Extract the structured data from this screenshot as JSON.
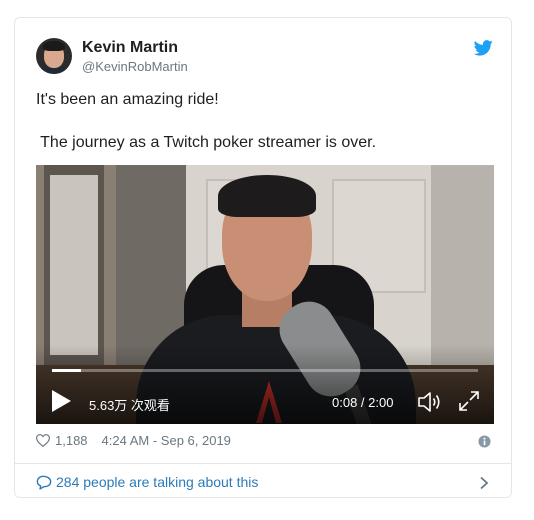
{
  "tweet": {
    "author_name": "Kevin Martin",
    "author_handle": "@KevinRobMartin",
    "text_line1": "It's been an amazing ride!",
    "text_line2": " The journey as a Twitch poker streamer is over.",
    "likes": "1,188",
    "timestamp": "4:24 AM - Sep 6, 2019",
    "talking": "284 people are talking about this"
  },
  "video": {
    "views": "5.63万 次观看",
    "time": "0:08 / 2:00",
    "progress_fraction": 0.067
  },
  "icons": {
    "brand": "twitter-bird-icon",
    "play": "play-icon",
    "volume": "volume-icon",
    "fullscreen": "fullscreen-icon",
    "like": "heart-icon",
    "info": "info-icon",
    "reply": "speech-bubble-icon",
    "chevron": "chevron-right-icon"
  },
  "colors": {
    "twitter_blue": "#1da1f2",
    "link_blue": "#2b7bb9",
    "muted_text": "#697882"
  }
}
